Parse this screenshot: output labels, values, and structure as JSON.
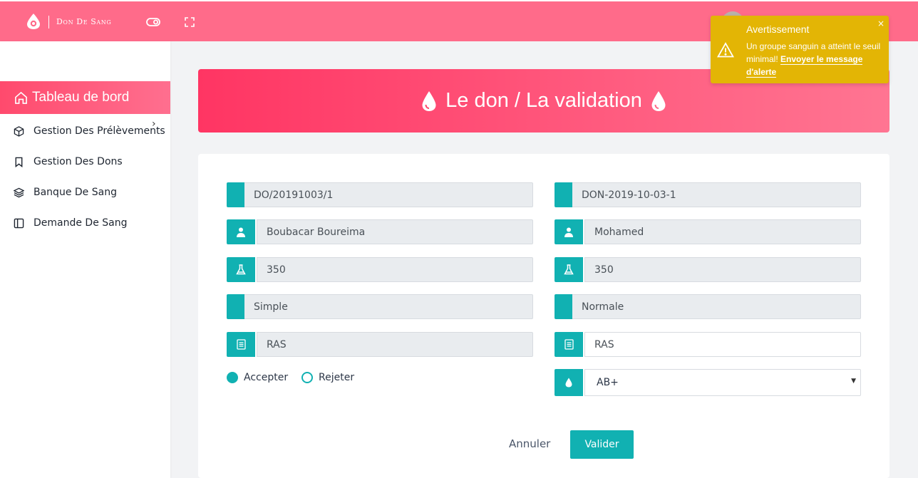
{
  "navbar": {
    "brand": "Don De Sang",
    "icons": [
      "blood-drop-logo-icon",
      "toggle-icon",
      "fullscreen-icon",
      "chevron-down-icon"
    ],
    "accent": "#ff6b8a"
  },
  "sidebar": {
    "items": [
      {
        "label": "Tableau de bord",
        "icon": "home-icon",
        "active": true
      },
      {
        "label": "Gestion Des Prélèvements",
        "icon": "box-icon",
        "has_submenu": true
      },
      {
        "label": "Gestion Des Dons",
        "icon": "bookmark-icon"
      },
      {
        "label": "Banque De Sang",
        "icon": "layers-icon"
      },
      {
        "label": "Demande De Sang",
        "icon": "sidebar-panel-icon"
      }
    ]
  },
  "banner": {
    "title": "Le don / La validation",
    "icon": "blood-drop-icon"
  },
  "form": {
    "left": {
      "reference": "DO/20191003/1",
      "donor_name": "Boubacar Boureima",
      "volume": "350",
      "type": "Simple",
      "note": "RAS"
    },
    "right": {
      "code": "DON-2019-10-03-1",
      "agent_name": "Mohamed",
      "volume": "350",
      "status": "Normale",
      "note": "RAS",
      "blood_group": "AB+"
    },
    "decision": {
      "accept_label": "Accepter",
      "reject_label": "Rejeter",
      "selected": "Accepter"
    },
    "actions": {
      "cancel_label": "Annuler",
      "submit_label": "Valider"
    },
    "accent": "#11b1b2"
  },
  "toast": {
    "title": "Avertissement",
    "message": "Un groupe sanguin a atteint le seuil minimal!",
    "link": "Envoyer le message d'alerte",
    "close": "×",
    "color": "#e3b505"
  }
}
